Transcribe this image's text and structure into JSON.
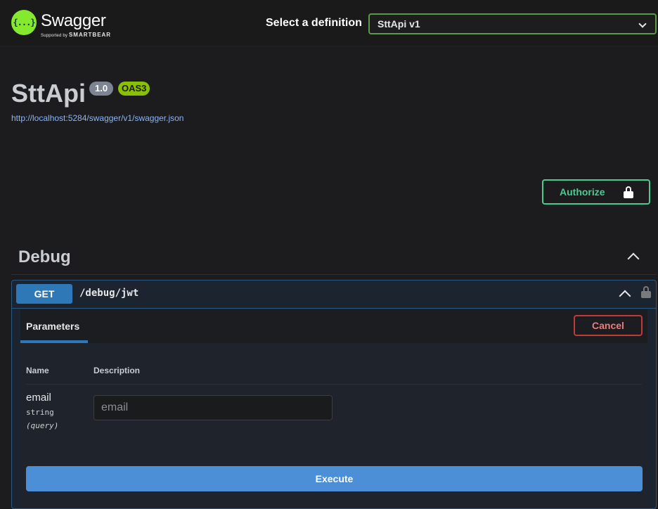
{
  "topbar": {
    "logo_glyph": "{...}",
    "brand": "Swagger",
    "brand_sub_prefix": "Supported by",
    "brand_sub_company": "SMARTBEAR",
    "select_label": "Select a definition",
    "selected_definition": "SttApi v1"
  },
  "info": {
    "title": "SttApi",
    "version": "1.0",
    "oas_badge": "OAS3",
    "spec_url": "http://localhost:5284/swagger/v1/swagger.json",
    "authorize_label": "Authorize"
  },
  "tag": {
    "name": "Debug",
    "expanded": true
  },
  "operation": {
    "method": "GET",
    "path": "/debug/jwt",
    "parameters_tab": "Parameters",
    "cancel_label": "Cancel",
    "columns": {
      "name": "Name",
      "description": "Description"
    },
    "parameters": [
      {
        "name": "email",
        "type": "string",
        "in": "(query)",
        "placeholder": "email",
        "value": ""
      }
    ],
    "execute_label": "Execute"
  },
  "colors": {
    "accent_green": "#49cc90",
    "get_blue": "#2f78b8",
    "oas_green": "#89bf04",
    "cancel_red": "#c0393b",
    "execute_blue": "#4d8fd6"
  }
}
